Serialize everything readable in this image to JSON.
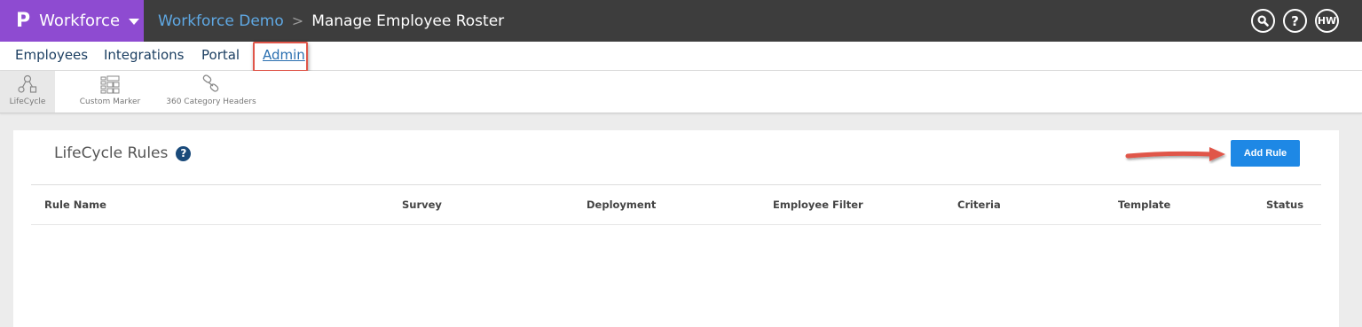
{
  "topbar": {
    "brand_logo": "P",
    "brand_name": "Workforce",
    "breadcrumb": {
      "parent": "Workforce Demo",
      "separator": ">",
      "current": "Manage Employee Roster"
    },
    "user_initials": "HW",
    "help_glyph": "?",
    "icons": [
      "search-icon",
      "help-icon",
      "user-avatar"
    ]
  },
  "nav": {
    "items": [
      {
        "label": "Employees"
      },
      {
        "label": "Integrations"
      },
      {
        "label": "Portal"
      },
      {
        "label": "Admin"
      }
    ],
    "active": "Admin"
  },
  "subnav": {
    "items": [
      {
        "label": "LifeCycle",
        "icon": "lifecycle-icon"
      },
      {
        "label": "Custom Marker",
        "icon": "custom-marker-icon"
      },
      {
        "label": "360 Category Headers",
        "icon": "category-headers-icon"
      }
    ],
    "active": "LifeCycle"
  },
  "main": {
    "title": "LifeCycle Rules",
    "help_glyph": "?",
    "add_button": "Add Rule",
    "columns": [
      "Rule Name",
      "Survey",
      "Deployment",
      "Employee Filter",
      "Criteria",
      "Template",
      "Status"
    ],
    "rows": []
  },
  "colors": {
    "brand": "#8e4bd1",
    "topbar": "#3d3d3d",
    "accent": "#1e88e5",
    "highlight": "#e0564a"
  }
}
